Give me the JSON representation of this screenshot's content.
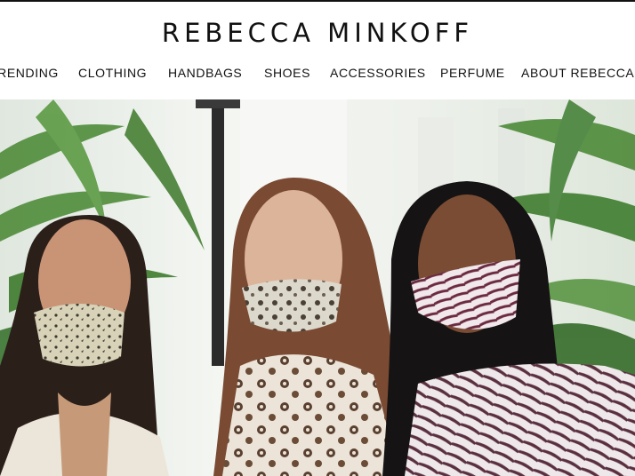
{
  "brand": {
    "logo_text": "REBECCA MINKOFF"
  },
  "nav": {
    "items": [
      {
        "label": "TRENDING"
      },
      {
        "label": "CLOTHING"
      },
      {
        "label": "HANDBAGS"
      },
      {
        "label": "SHOES"
      },
      {
        "label": "ACCESSORIES"
      },
      {
        "label": "PERFUME"
      },
      {
        "label": "ABOUT REBECCA"
      }
    ]
  },
  "hero": {
    "description": "hero-photo-three-women-wearing-printed-face-masks"
  },
  "colors": {
    "text": "#111111",
    "background": "#ffffff"
  }
}
